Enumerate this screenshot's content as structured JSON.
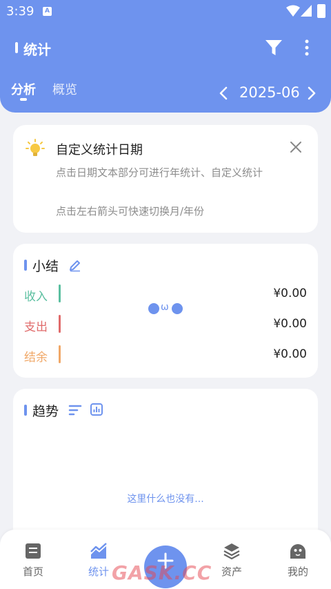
{
  "status_bar": {
    "time": "3:39",
    "app_icon_letter": "A"
  },
  "header": {
    "title": "统计",
    "tabs": [
      {
        "label": "分析",
        "active": true
      },
      {
        "label": "概览",
        "active": false
      }
    ],
    "period": "2025-06"
  },
  "tip_card": {
    "title": "自定义统计日期",
    "line1": "点击日期文本部分可进行年统计、自定义统计",
    "line2": "点击左右箭头可快速切换月/年份"
  },
  "summary": {
    "title": "小结",
    "rows": [
      {
        "label": "收入",
        "value": "¥0.00",
        "color": "#5bbfa0"
      },
      {
        "label": "支出",
        "value": "¥0.00",
        "color": "#e06b6b"
      },
      {
        "label": "结余",
        "value": "¥0.00",
        "color": "#f0a868"
      }
    ],
    "face_mouth": "ω"
  },
  "trend": {
    "title": "趋势",
    "empty_text": "这里什么也没有..."
  },
  "bottom_nav": {
    "items": [
      {
        "label": "首页",
        "icon": "home-icon"
      },
      {
        "label": "统计",
        "icon": "stats-icon",
        "active": true
      },
      {
        "label": "资产",
        "icon": "layers-icon"
      },
      {
        "label": "我的",
        "icon": "profile-icon"
      }
    ],
    "add_icon": "plus-icon"
  },
  "watermark": "GASK.CC",
  "colors": {
    "accent": "#6e93ee",
    "background": "#f1f2f6"
  }
}
